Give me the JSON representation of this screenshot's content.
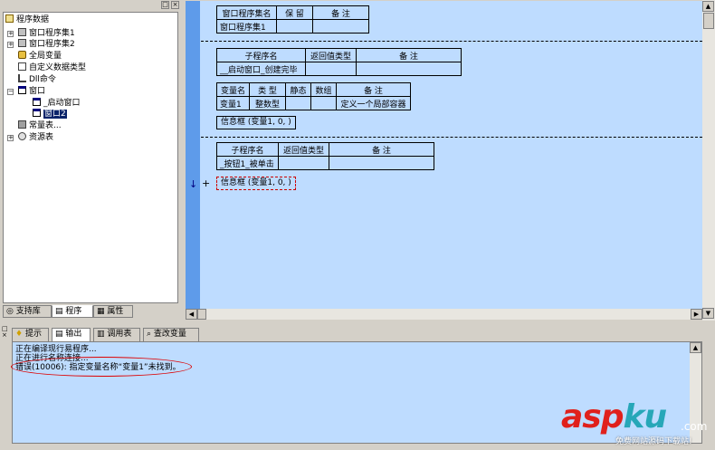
{
  "tree": {
    "root_label": "程序数据",
    "items": [
      {
        "label": "窗口程序集1"
      },
      {
        "label": "窗口程序集2"
      },
      {
        "label": "全局变量"
      },
      {
        "label": "自定义数据类型"
      },
      {
        "label": "Dll命令"
      },
      {
        "label": "窗口"
      },
      {
        "label": "_启动窗口"
      },
      {
        "label": "窗口2"
      },
      {
        "label": "常量表..."
      },
      {
        "label": "资源表"
      }
    ],
    "header_btns": [
      "□",
      "×"
    ]
  },
  "left_tabs": [
    "支持库",
    "程序",
    "属性"
  ],
  "code": {
    "assembly_table": {
      "headers": [
        "窗口程序集名",
        "保 留",
        "备 注"
      ],
      "row": [
        "窗口程序集1",
        "",
        ""
      ]
    },
    "sub1_table": {
      "headers": [
        "子程序名",
        "返回值类型",
        "备 注"
      ],
      "row": [
        "__启动窗口_创建完毕",
        "",
        ""
      ]
    },
    "var_table": {
      "headers": [
        "变量名",
        "类 型",
        "静态",
        "数组",
        "备 注"
      ],
      "row": [
        "变量1",
        "整数型",
        "",
        "",
        "定义一个局部容器"
      ]
    },
    "stmt1": "信息框 (变量1, 0, )",
    "sub2_table": {
      "headers": [
        "子程序名",
        "返回值类型",
        "备 注"
      ],
      "row": [
        "_按钮1_被单击",
        "",
        ""
      ]
    },
    "stmt2": "信息框 (变量1, 0, )",
    "gutter_arrow": "↓",
    "gutter_plus": "+"
  },
  "bottom_tabs": [
    "提示",
    "输出",
    "调用表",
    "查改变量"
  ],
  "output_lines": [
    "正在编译现行易程序...",
    "正在进行名称连接...",
    "错误(10006): 指定变量名称“变量1”未找到。"
  ],
  "watermark": {
    "brand_asp": "asp",
    "brand_ku": "ku",
    "brand_com": ".com",
    "tagline": "免费网站源码下载站!"
  },
  "colors": {
    "editor_bg": "#bedcff",
    "gutter": "#5e9bea",
    "watermark_red": "#e0201b",
    "watermark_teal": "#27a7b8",
    "error_ellipse": "#dd0000"
  }
}
